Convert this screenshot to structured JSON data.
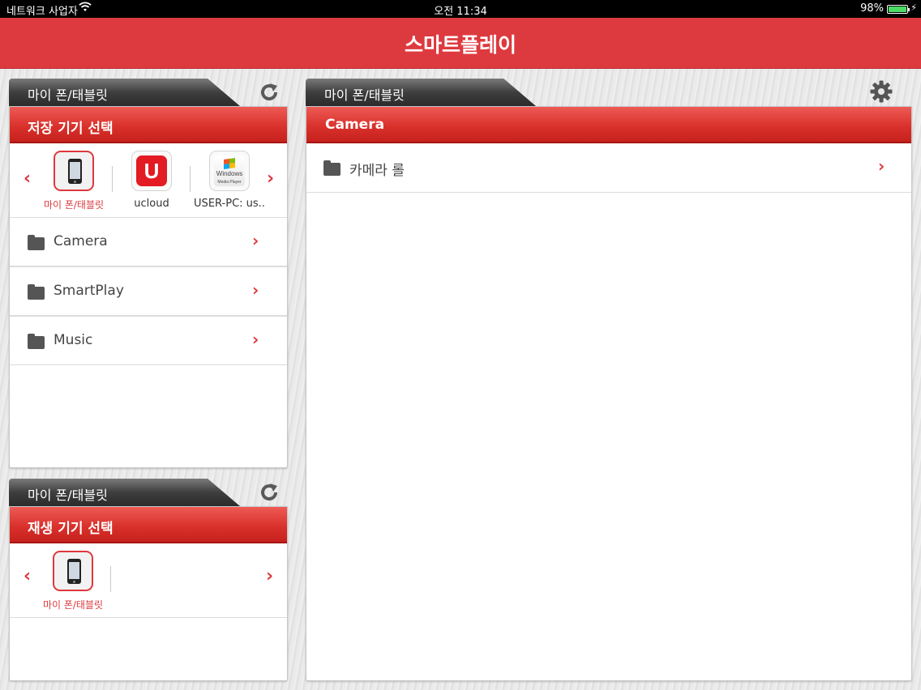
{
  "status_bar": {
    "carrier": "네트워크 사업자",
    "time": "오전 11:34",
    "battery": "98%"
  },
  "app": {
    "title": "스마트플레이"
  },
  "storage_section": {
    "tab_label": "마이 폰/태블릿",
    "header": "저장 기기 선택",
    "devices": [
      {
        "label": "마이 폰/태블릿",
        "icon": "phone-icon",
        "selected": true
      },
      {
        "label": "ucloud",
        "icon": "ucloud-icon",
        "selected": false
      },
      {
        "label": "USER-PC: us..",
        "icon": "windows-media-player-icon",
        "wmp_text": "Windows",
        "wmp_sub": "Media Player",
        "selected": false
      }
    ],
    "folders": [
      {
        "label": "Camera",
        "icon": "folder-icon"
      },
      {
        "label": "SmartPlay",
        "icon": "folder-icon"
      },
      {
        "label": "Music",
        "icon": "folder-icon"
      }
    ]
  },
  "playback_section": {
    "tab_label": "마이 폰/태블릿",
    "header": "재생 기기 선택",
    "devices": [
      {
        "label": "마이 폰/태블릿",
        "icon": "phone-icon",
        "selected": true
      }
    ]
  },
  "content_panel": {
    "tab_label": "마이 폰/태블릿",
    "header": "Camera",
    "items": [
      {
        "label": "카메라 롤",
        "icon": "folder-icon"
      }
    ]
  },
  "colors": {
    "accent": "#dd3a3f",
    "header_red": "#d9302b",
    "tab_dark": "#3e3e3e"
  }
}
